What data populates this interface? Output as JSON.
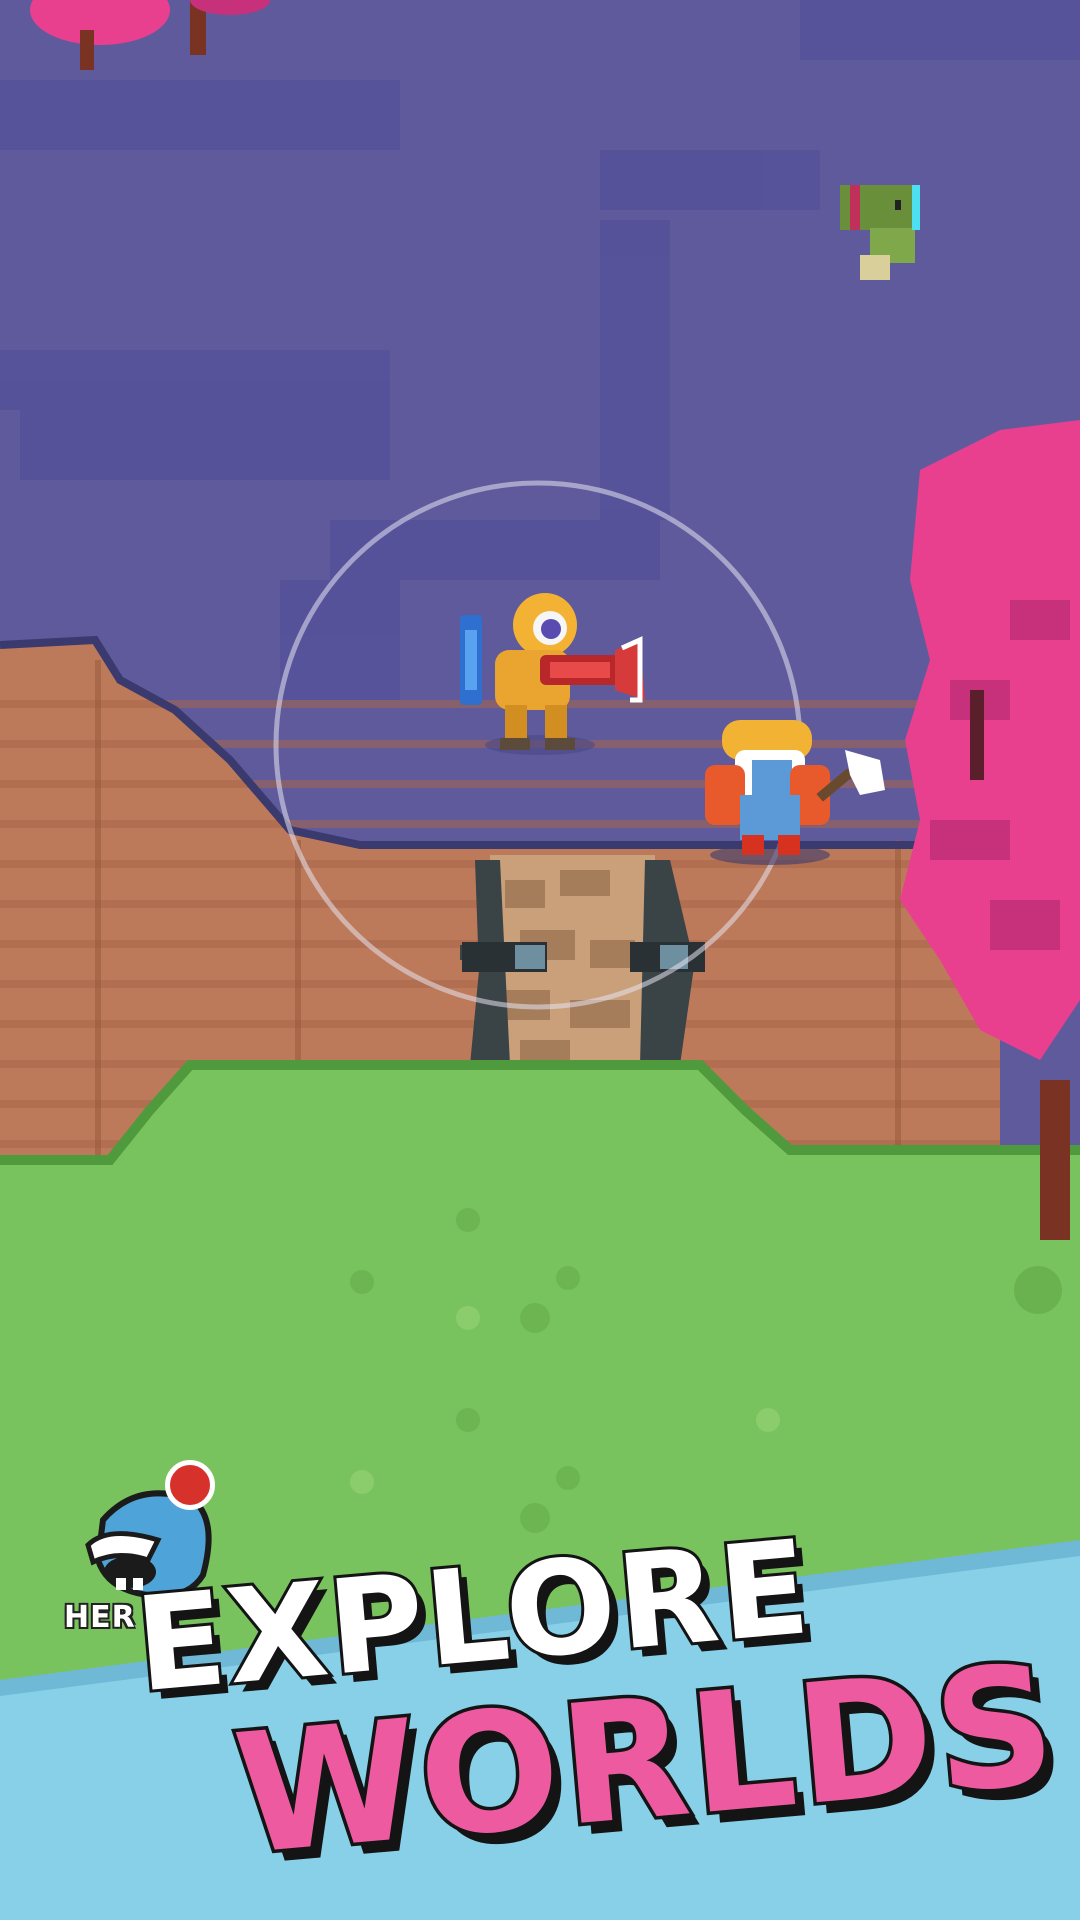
{
  "screen": {
    "type": "game-promo-screenshot",
    "colors": {
      "sky": "#5e5a9c",
      "sky_dark": "#4f4b8b",
      "dirt": "#bd7a5a",
      "dirt_stripe": "#a8664a",
      "grass": "#79c35e",
      "grass_edge": "#5aa845",
      "tree_pink": "#e8408f",
      "banner_blue": "#87d0e8",
      "accent_pink": "#ee5aa0"
    }
  },
  "hud": {
    "heroes_button": {
      "label": "HER",
      "icon": "hero-avatar-icon",
      "notification": true
    }
  },
  "promo": {
    "line1": "EXPLORE",
    "line2": "WORLDS"
  }
}
